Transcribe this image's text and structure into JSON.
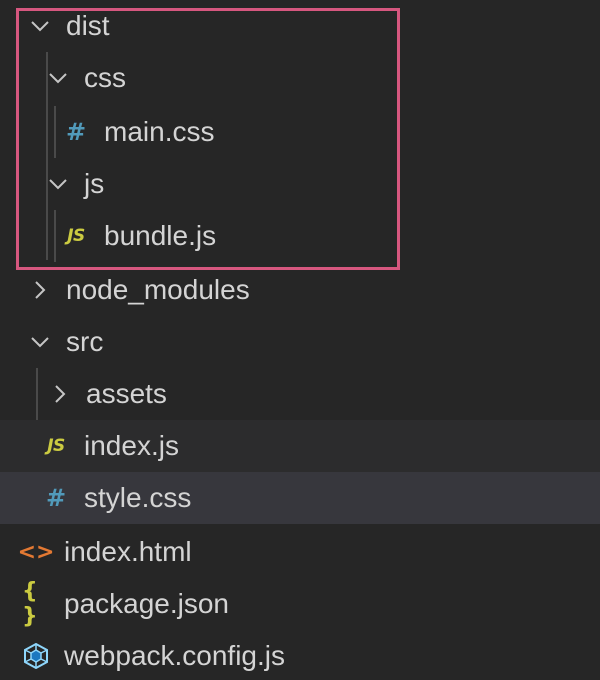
{
  "explorer": {
    "items": [
      {
        "label": "dist",
        "type": "folder",
        "expanded": true
      },
      {
        "label": "css",
        "type": "folder",
        "expanded": true
      },
      {
        "label": "main.css",
        "type": "file",
        "icon": "css-file-icon",
        "icon_glyph": "#"
      },
      {
        "label": "js",
        "type": "folder",
        "expanded": true
      },
      {
        "label": "bundle.js",
        "type": "file",
        "icon": "js-file-icon",
        "icon_glyph": "JS"
      },
      {
        "label": "node_modules",
        "type": "folder",
        "expanded": false
      },
      {
        "label": "src",
        "type": "folder",
        "expanded": true
      },
      {
        "label": "assets",
        "type": "folder",
        "expanded": false
      },
      {
        "label": "index.js",
        "type": "file",
        "icon": "js-file-icon",
        "icon_glyph": "JS"
      },
      {
        "label": "style.css",
        "type": "file",
        "icon": "css-file-icon",
        "icon_glyph": "#"
      },
      {
        "label": "index.html",
        "type": "file",
        "icon": "html-file-icon",
        "icon_glyph": "<>"
      },
      {
        "label": "package.json",
        "type": "file",
        "icon": "json-file-icon",
        "icon_glyph": "{ }"
      },
      {
        "label": "webpack.config.js",
        "type": "file",
        "icon": "webpack-icon"
      }
    ]
  },
  "colors": {
    "background": "#262626",
    "text": "#d4d4d4",
    "chevron": "#c5c5c5",
    "indent_guide": "#4a4a4a",
    "highlight_border": "#d6577f",
    "js_icon": "#cbcb41",
    "css_icon": "#519aba",
    "html_icon": "#e37933",
    "webpack_icon": "#8ed6fb",
    "selected_row": "#37373d",
    "hover_row": "#2c2c2d"
  }
}
